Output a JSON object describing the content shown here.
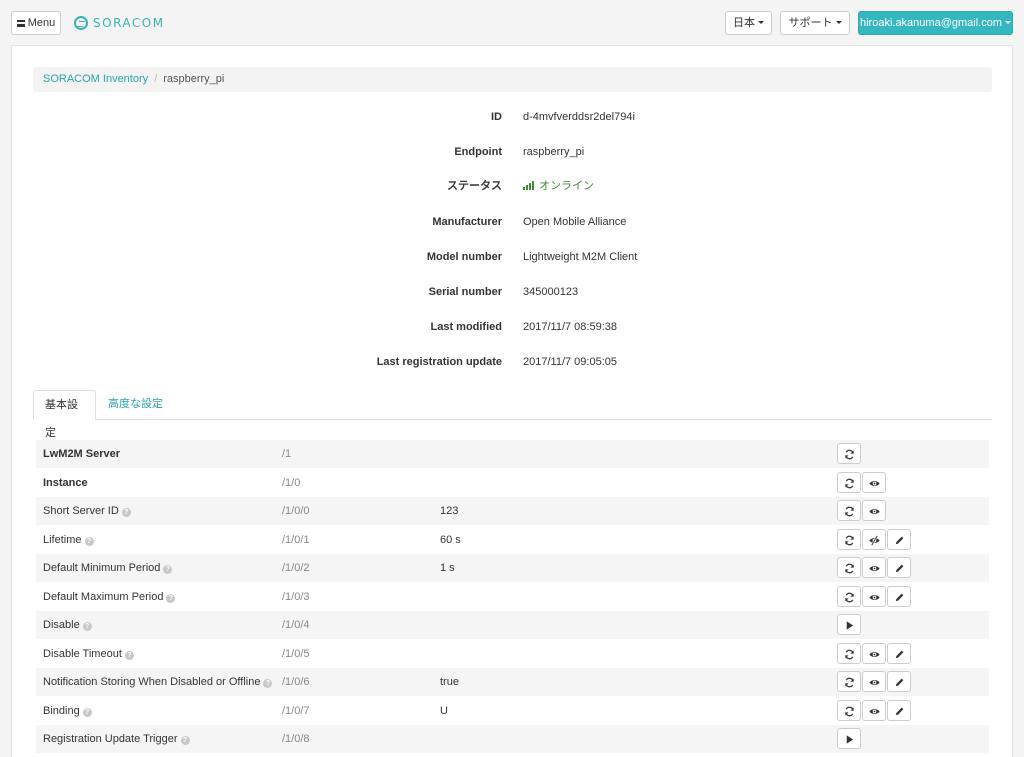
{
  "nav": {
    "menu_label": "Menu",
    "logo_text": "SORACOM",
    "language_label": "日本",
    "support_label": "サポート",
    "user_label": "hiroaki.akanuma@gmail.com"
  },
  "breadcrumb": {
    "root": "SORACOM Inventory",
    "current": "raspberry_pi"
  },
  "properties": [
    {
      "label": "ID",
      "value": "d-4mvfverddsr2del794i"
    },
    {
      "label": "Endpoint",
      "value": "raspberry_pi"
    },
    {
      "label": "ステータス",
      "value": "オンライン"
    },
    {
      "label": "Manufacturer",
      "value": "Open Mobile Alliance"
    },
    {
      "label": "Model number",
      "value": "Lightweight M2M Client"
    },
    {
      "label": "Serial number",
      "value": "345000123"
    },
    {
      "label": "Last modified",
      "value": "2017/11/7 08:59:38"
    },
    {
      "label": "Last registration update",
      "value": "2017/11/7 09:05:05"
    }
  ],
  "status_color": "#3c8d2f",
  "accent_color": "#35b7c0",
  "tabs": [
    {
      "label": "基本設定",
      "active": true
    },
    {
      "label": "高度な設定",
      "active": false
    }
  ],
  "resources": [
    {
      "name": "LwM2M Server",
      "path": "/1",
      "value": "",
      "bold": true,
      "help": false,
      "actions": [
        "refresh-icon"
      ]
    },
    {
      "name": "Instance",
      "path": "/1/0",
      "value": "",
      "bold": true,
      "help": false,
      "actions": [
        "refresh-icon",
        "eye-icon"
      ]
    },
    {
      "name": "Short Server ID",
      "path": "/1/0/0",
      "value": "123",
      "bold": false,
      "help": true,
      "actions": [
        "refresh-icon",
        "eye-icon"
      ]
    },
    {
      "name": "Lifetime",
      "path": "/1/0/1",
      "value": "60 s",
      "bold": false,
      "help": true,
      "actions": [
        "refresh-icon",
        "eye-slash-icon",
        "pencil-icon"
      ]
    },
    {
      "name": "Default Minimum Period",
      "path": "/1/0/2",
      "value": "1 s",
      "bold": false,
      "help": true,
      "actions": [
        "refresh-icon",
        "eye-icon",
        "pencil-icon"
      ]
    },
    {
      "name": "Default Maximum Period",
      "path": "/1/0/3",
      "value": "",
      "bold": false,
      "help": true,
      "actions": [
        "refresh-icon",
        "eye-icon",
        "pencil-icon"
      ]
    },
    {
      "name": "Disable",
      "path": "/1/0/4",
      "value": "",
      "bold": false,
      "help": true,
      "actions": [
        "play-icon"
      ]
    },
    {
      "name": "Disable Timeout",
      "path": "/1/0/5",
      "value": "",
      "bold": false,
      "help": true,
      "actions": [
        "refresh-icon",
        "eye-icon",
        "pencil-icon"
      ]
    },
    {
      "name": "Notification Storing When Disabled or Offline",
      "path": "/1/0/6",
      "value": "true",
      "bold": false,
      "help": true,
      "actions": [
        "refresh-icon",
        "eye-icon",
        "pencil-icon"
      ]
    },
    {
      "name": "Binding",
      "path": "/1/0/7",
      "value": "U",
      "bold": false,
      "help": true,
      "actions": [
        "refresh-icon",
        "eye-icon",
        "pencil-icon"
      ]
    },
    {
      "name": "Registration Update Trigger",
      "path": "/1/0/8",
      "value": "",
      "bold": false,
      "help": true,
      "actions": [
        "play-icon"
      ]
    }
  ]
}
